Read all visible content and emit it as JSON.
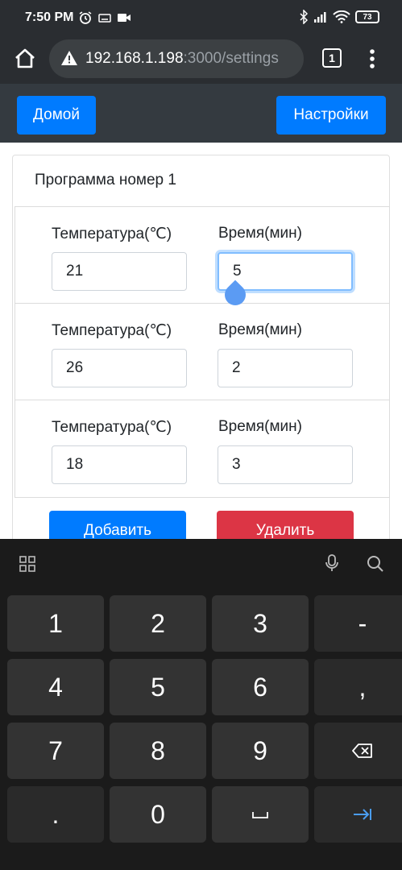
{
  "status_bar": {
    "time": "7:50 PM",
    "left_icons": [
      "alarm-icon",
      "keyboard-icon",
      "video-icon"
    ],
    "right_icons": [
      "bluetooth-icon",
      "signal-icon",
      "wifi-icon"
    ],
    "battery": "73"
  },
  "browser": {
    "url_host": "192.168.1.198",
    "url_rest": ":3000/settings",
    "tab_count": "1"
  },
  "navbar": {
    "home_label": "Домой",
    "settings_label": "Настройки"
  },
  "card": {
    "title": "Программа номер 1",
    "rows": [
      {
        "temp_label": "Температура(℃)",
        "time_label": "Время(мин)",
        "temp_value": "21",
        "time_value": "5"
      },
      {
        "temp_label": "Температура(℃)",
        "time_label": "Время(мин)",
        "temp_value": "26",
        "time_value": "2"
      },
      {
        "temp_label": "Температура(℃)",
        "time_label": "Время(мин)",
        "temp_value": "18",
        "time_value": "3"
      }
    ],
    "add_label": "Добавить",
    "delete_label": "Удалить"
  },
  "keyboard": {
    "keys": [
      [
        "1",
        "2",
        "3",
        "-"
      ],
      [
        "4",
        "5",
        "6",
        ","
      ],
      [
        "7",
        "8",
        "9",
        "backspace-icon"
      ],
      [
        ".",
        "0",
        "space-icon",
        "tab-icon"
      ]
    ]
  },
  "colors": {
    "primary": "#007bff",
    "danger": "#dc3545",
    "navbar": "#343a40"
  }
}
